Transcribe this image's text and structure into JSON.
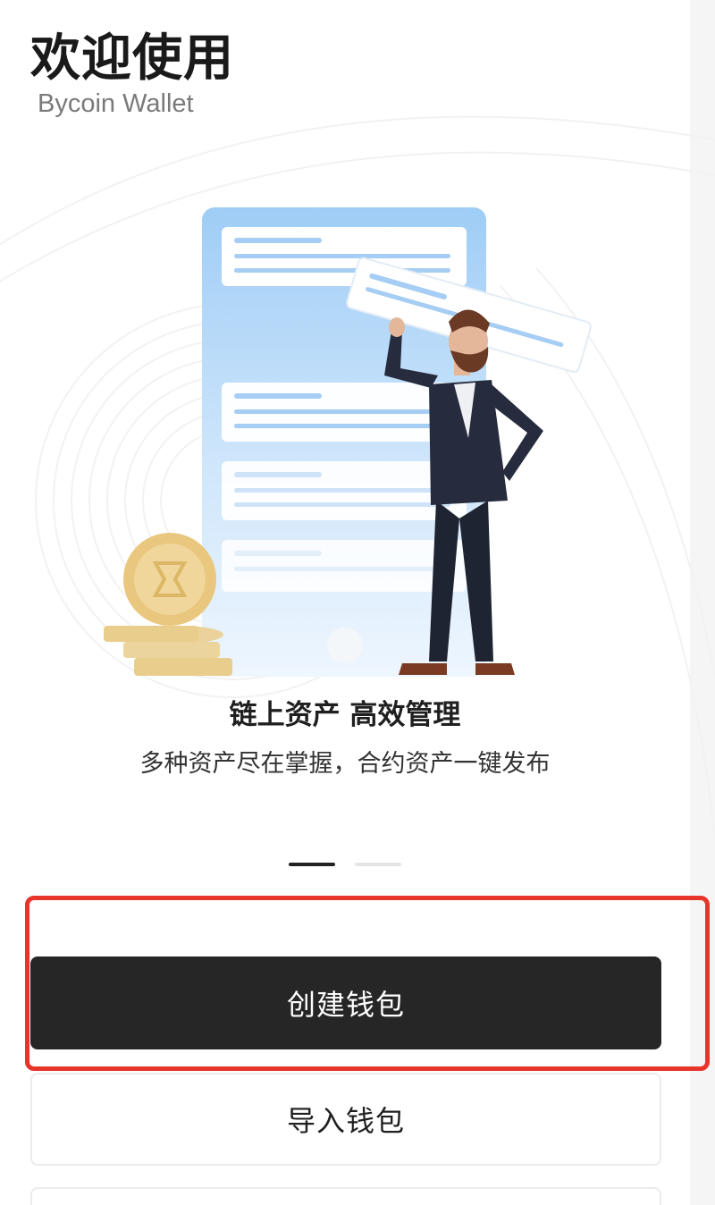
{
  "header": {
    "title": "欢迎使用",
    "subtitle": "Bycoin Wallet"
  },
  "slide": {
    "title": "链上资产 高效管理",
    "description": "多种资产尽在掌握，合约资产一键发布",
    "illustration": "phone-businessman-coins-illustration"
  },
  "pager": {
    "total": 2,
    "active_index": 0
  },
  "actions": {
    "create_label": "创建钱包",
    "import_label": "导入钱包"
  },
  "colors": {
    "primary_button": "#262626",
    "highlight_border": "#e8352b",
    "phone_blue": "#a9d1f7",
    "coin_gold": "#e9c77e"
  }
}
